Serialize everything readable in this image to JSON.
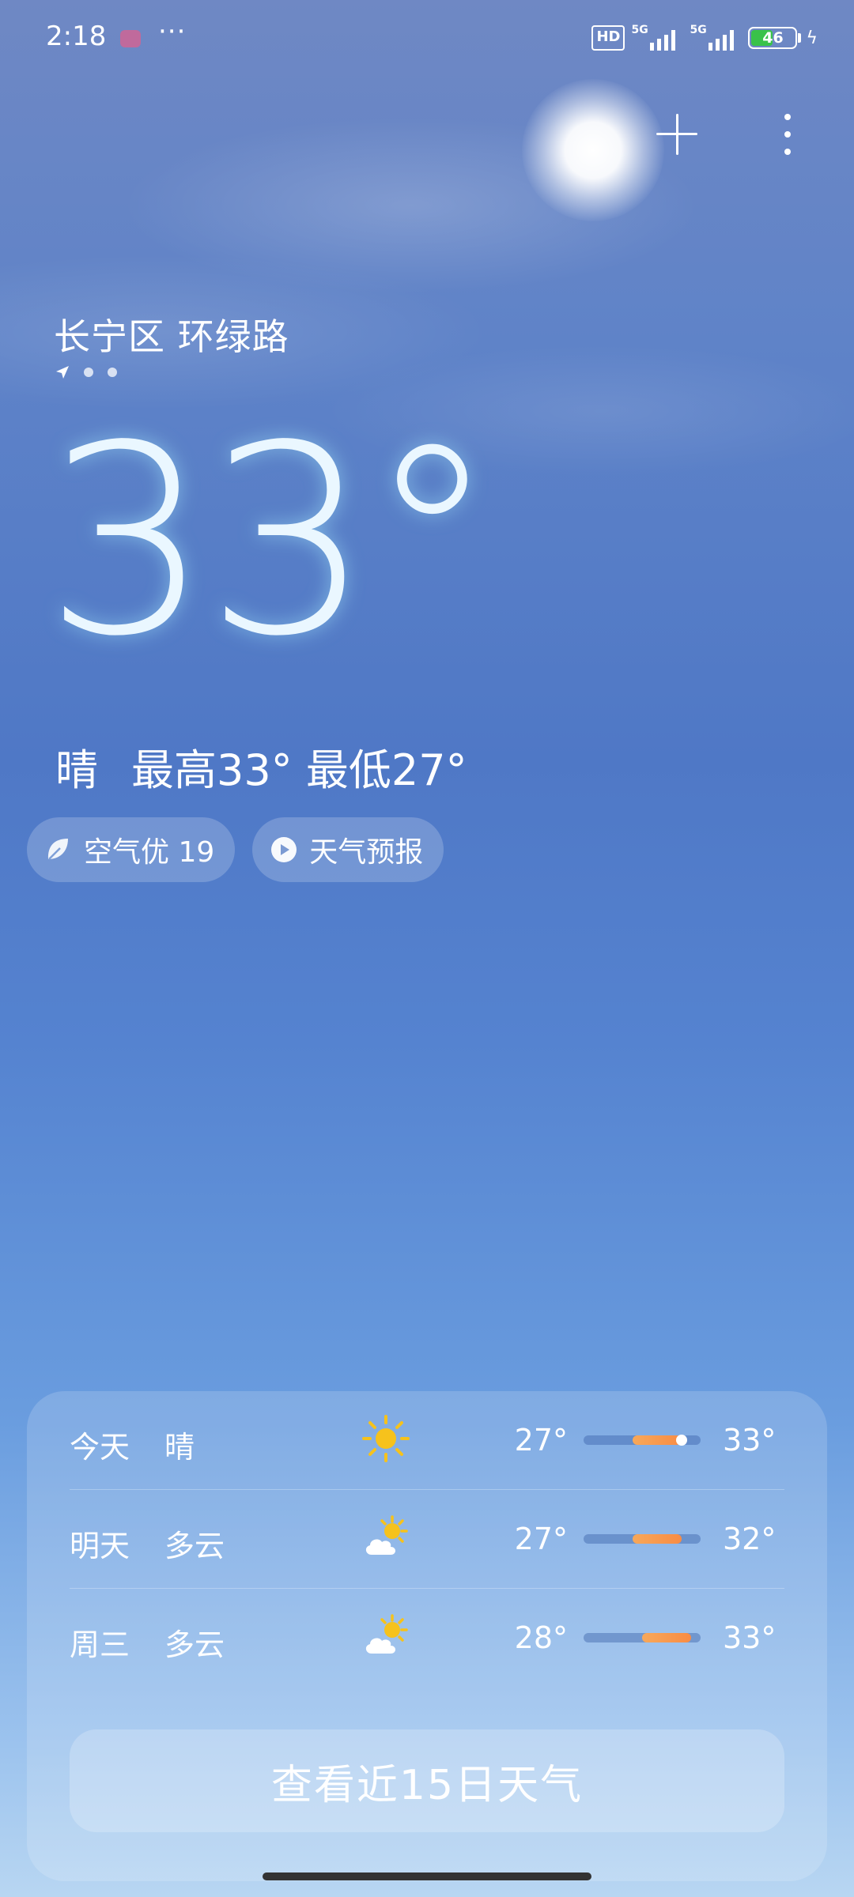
{
  "status_bar": {
    "time": "2:18",
    "more": "···",
    "hd": "HD",
    "net1": "5G",
    "net2": "5G",
    "battery": "46"
  },
  "location": {
    "name": "长宁区 环绿路",
    "page_count": 3
  },
  "current": {
    "temperature": "33°",
    "condition": "晴",
    "high_label": "最高33°",
    "low_label": "最低27°"
  },
  "chips": {
    "air_quality": "空气优 19",
    "forecast_video": "天气预报"
  },
  "forecast": [
    {
      "day": "今天",
      "condition": "晴",
      "icon": "sun-icon",
      "low": "27°",
      "high": "33°",
      "range": [
        0.42,
        0.84
      ],
      "now_marker": 0.84
    },
    {
      "day": "明天",
      "condition": "多云",
      "icon": "partly-cloudy-icon",
      "low": "27°",
      "high": "32°",
      "range": [
        0.42,
        0.84
      ]
    },
    {
      "day": "周三",
      "condition": "多云",
      "icon": "partly-cloudy-icon",
      "low": "28°",
      "high": "33°",
      "range": [
        0.5,
        0.92
      ]
    }
  ],
  "cta": {
    "label": "查看近15日天气"
  },
  "colors": {
    "accent": "#f98c44",
    "battery": "#39c24a"
  }
}
